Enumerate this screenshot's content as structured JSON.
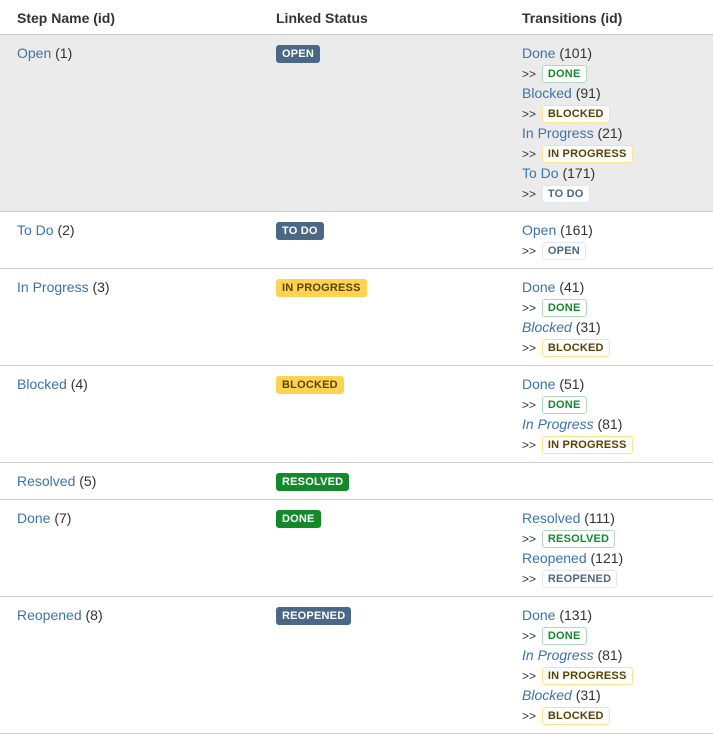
{
  "headers": {
    "step": "Step Name (id)",
    "status": "Linked Status",
    "transitions": "Transitions (id)"
  },
  "arrow": ">>",
  "rows": [
    {
      "name": "Open",
      "id": "(1)",
      "status": "OPEN",
      "status_style": "solid-blue",
      "highlight": true,
      "transitions": [
        {
          "name": "Done",
          "id": "(101)",
          "target": "DONE",
          "style": "sub-green",
          "italic": false
        },
        {
          "name": "Blocked",
          "id": "(91)",
          "target": "BLOCKED",
          "style": "sub-yellow",
          "italic": false
        },
        {
          "name": "In Progress",
          "id": "(21)",
          "target": "IN PROGRESS",
          "style": "sub-yellow",
          "italic": false
        },
        {
          "name": "To Do",
          "id": "(171)",
          "target": "TO DO",
          "style": "sub-blue",
          "italic": false
        }
      ]
    },
    {
      "name": "To Do",
      "id": "(2)",
      "status": "TO DO",
      "status_style": "solid-blue",
      "highlight": false,
      "transitions": [
        {
          "name": "Open",
          "id": "(161)",
          "target": "OPEN",
          "style": "sub-blue",
          "italic": false
        }
      ]
    },
    {
      "name": "In Progress",
      "id": "(3)",
      "status": "IN PROGRESS",
      "status_style": "solid-yellow",
      "highlight": false,
      "transitions": [
        {
          "name": "Done",
          "id": "(41)",
          "target": "DONE",
          "style": "sub-green",
          "italic": false
        },
        {
          "name": "Blocked",
          "id": "(31)",
          "target": "BLOCKED",
          "style": "sub-yellow",
          "italic": true
        }
      ]
    },
    {
      "name": "Blocked",
      "id": "(4)",
      "status": "BLOCKED",
      "status_style": "solid-yellow",
      "highlight": false,
      "transitions": [
        {
          "name": "Done",
          "id": "(51)",
          "target": "DONE",
          "style": "sub-green",
          "italic": false
        },
        {
          "name": "In Progress",
          "id": "(81)",
          "target": "IN PROGRESS",
          "style": "sub-yellow",
          "italic": true
        }
      ]
    },
    {
      "name": "Resolved",
      "id": "(5)",
      "status": "RESOLVED",
      "status_style": "solid-green",
      "highlight": false,
      "transitions": []
    },
    {
      "name": "Done",
      "id": "(7)",
      "status": "DONE",
      "status_style": "solid-green",
      "highlight": false,
      "transitions": [
        {
          "name": "Resolved",
          "id": "(111)",
          "target": "RESOLVED",
          "style": "sub-green",
          "italic": false
        },
        {
          "name": "Reopened",
          "id": "(121)",
          "target": "REOPENED",
          "style": "sub-blue",
          "italic": false
        }
      ]
    },
    {
      "name": "Reopened",
      "id": "(8)",
      "status": "REOPENED",
      "status_style": "solid-blue",
      "highlight": false,
      "transitions": [
        {
          "name": "Done",
          "id": "(131)",
          "target": "DONE",
          "style": "sub-green",
          "italic": false
        },
        {
          "name": "In Progress",
          "id": "(81)",
          "target": "IN PROGRESS",
          "style": "sub-yellow",
          "italic": true
        },
        {
          "name": "Blocked",
          "id": "(31)",
          "target": "BLOCKED",
          "style": "sub-yellow",
          "italic": true
        }
      ]
    }
  ]
}
